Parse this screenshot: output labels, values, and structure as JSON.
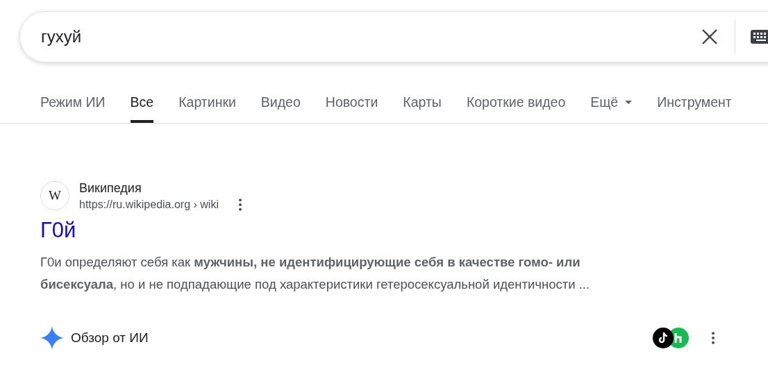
{
  "search": {
    "value": "гухуй"
  },
  "tabs": [
    {
      "label": "Режим ИИ",
      "selected": false,
      "kind": "plain"
    },
    {
      "label": "Все",
      "selected": true,
      "kind": "plain"
    },
    {
      "label": "Картинки",
      "selected": false,
      "kind": "plain"
    },
    {
      "label": "Видео",
      "selected": false,
      "kind": "plain"
    },
    {
      "label": "Новости",
      "selected": false,
      "kind": "plain"
    },
    {
      "label": "Карты",
      "selected": false,
      "kind": "plain"
    },
    {
      "label": "Короткие видео",
      "selected": false,
      "kind": "plain"
    },
    {
      "label": "Ещё",
      "selected": false,
      "kind": "menu"
    },
    {
      "label": "Инструмент",
      "selected": false,
      "kind": "plain"
    }
  ],
  "result": {
    "favicon_letter": "W",
    "site": "Википедия",
    "url": "https://ru.wikipedia.org › wiki",
    "title": "Г0й",
    "snippet": "Г0и определяют себя как **мужчины, не идентифицирующие себя в качестве гомо- или бисексуала**, но и не подпадающие под характеристики гетеросексуальной идентичности ..."
  },
  "ai_overview": {
    "title": "Обзор от ИИ"
  }
}
